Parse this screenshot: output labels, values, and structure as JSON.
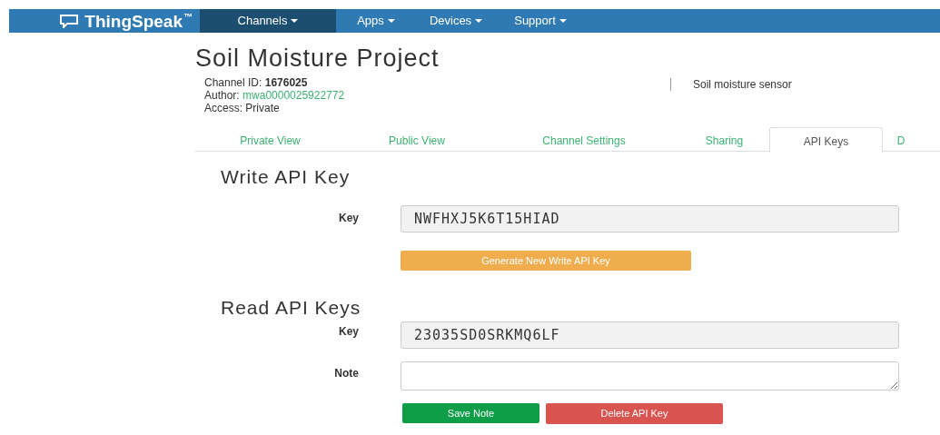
{
  "navbar": {
    "brand": "ThingSpeak",
    "trademark": "™",
    "menus": [
      {
        "label": "Channels",
        "selected": true
      },
      {
        "label": "Apps",
        "selected": false
      },
      {
        "label": "Devices",
        "selected": false
      },
      {
        "label": "Support",
        "selected": false
      }
    ]
  },
  "channel": {
    "title": "Soil Moisture Project",
    "id_label": "Channel ID:",
    "id": "1676025",
    "author_label": "Author:",
    "author": "mwa0000025922772",
    "access": "Access: Private",
    "description": "Soil moisture sensor"
  },
  "tabs": [
    {
      "label": "Private View",
      "selected": false
    },
    {
      "label": "Public View",
      "selected": false
    },
    {
      "label": "Channel Settings",
      "selected": false
    },
    {
      "label": "Sharing",
      "selected": false
    },
    {
      "label": "API Keys",
      "selected": true
    },
    {
      "label": "D",
      "selected": false
    }
  ],
  "write_key": {
    "heading": "Write API Key",
    "key_label": "Key",
    "key": "NWFHXJ5K6T15HIAD",
    "button": "Generate New Write API Key"
  },
  "read_key": {
    "heading": "Read API Keys",
    "key_label": "Key",
    "key": "23035SD0SRKMQ6LF",
    "note_label": "Note",
    "save_button": "Save Note",
    "delete_button": "Delete API Key"
  }
}
